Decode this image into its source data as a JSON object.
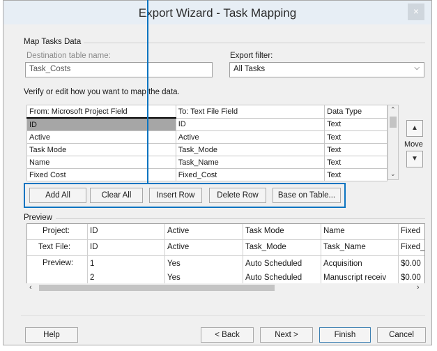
{
  "window": {
    "title": "Export Wizard - Task Mapping",
    "close_glyph": "×"
  },
  "map_tasks": {
    "group_label": "Map Tasks Data",
    "destination_label": "Destination table name:",
    "destination_value": "Task_Costs",
    "export_filter_label": "Export filter:",
    "export_filter_value": "All Tasks"
  },
  "verify_label": "Verify or edit how you want to map the data.",
  "mapping_table": {
    "headers": [
      "From: Microsoft Project Field",
      "To: Text File Field",
      "Data Type"
    ],
    "rows": [
      [
        "ID",
        "ID",
        "Text"
      ],
      [
        "Active",
        "Active",
        "Text"
      ],
      [
        "Task Mode",
        "Task_Mode",
        "Text"
      ],
      [
        "Name",
        "Task_Name",
        "Text"
      ],
      [
        "Fixed Cost",
        "Fixed_Cost",
        "Text"
      ]
    ]
  },
  "move": {
    "label": "Move",
    "up_glyph": "▲",
    "down_glyph": "▼"
  },
  "row_buttons": {
    "add_all": "Add All",
    "clear_all": "Clear All",
    "insert_row": "Insert Row",
    "delete_row": "Delete Row",
    "base_on_table": "Base on Table..."
  },
  "preview": {
    "group_label": "Preview",
    "row_labels": [
      "Project:",
      "Text File:",
      "Preview:"
    ],
    "project_row": [
      "ID",
      "Active",
      "Task Mode",
      "Name",
      "Fixed"
    ],
    "textfile_row": [
      "ID",
      "Active",
      "Task_Mode",
      "Task_Name",
      "Fixed_"
    ],
    "data_row1": [
      "1",
      "Yes",
      "Auto Scheduled",
      "Acquisition",
      "$0.00"
    ],
    "data_row2": [
      "2",
      "Yes",
      "Auto Scheduled",
      "Manuscript receiv",
      "$0.00"
    ]
  },
  "footer": {
    "help": "Help",
    "back": "< Back",
    "next": "Next >",
    "finish": "Finish",
    "cancel": "Cancel"
  },
  "colors": {
    "callout": "#0b74c1",
    "selection": "#a6a6a6",
    "titlebar": "#e7eef5"
  }
}
